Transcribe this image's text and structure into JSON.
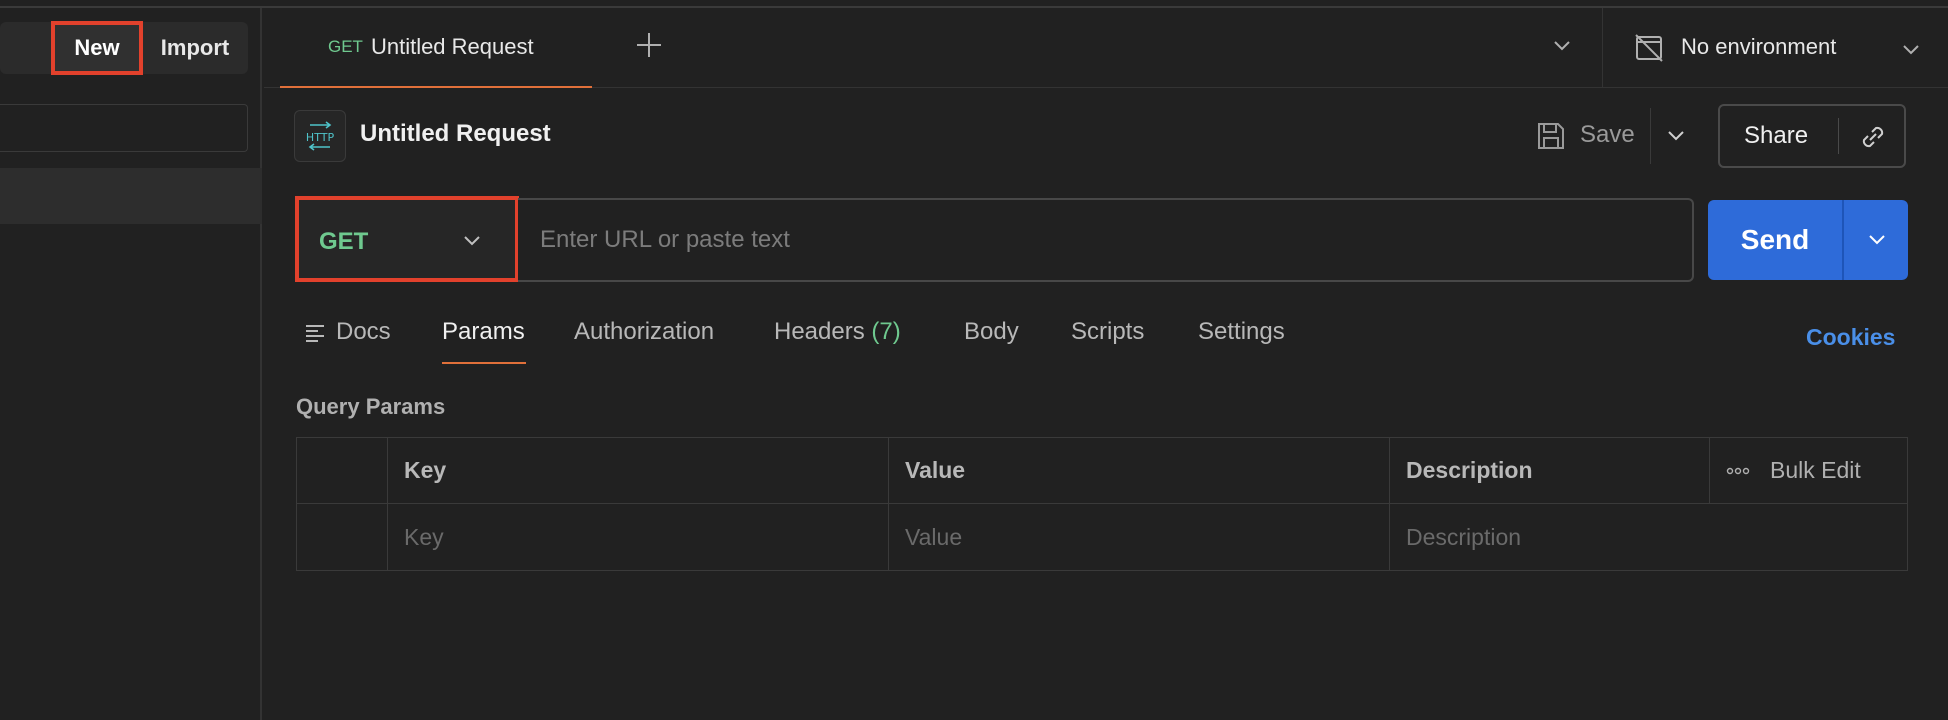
{
  "sidebar": {
    "new_label": "New",
    "import_label": "Import"
  },
  "tabbar": {
    "tab_method": "GET",
    "tab_title": "Untitled Request",
    "environment": "No environment"
  },
  "request": {
    "title": "Untitled Request",
    "save_label": "Save",
    "share_label": "Share",
    "method": "GET",
    "url_placeholder": "Enter URL or paste text",
    "send_label": "Send"
  },
  "subtabs": {
    "docs": "Docs",
    "params": "Params",
    "authorization": "Authorization",
    "headers": "Headers",
    "headers_count": "(7)",
    "body": "Body",
    "scripts": "Scripts",
    "settings": "Settings",
    "cookies": "Cookies"
  },
  "query_params": {
    "title": "Query Params",
    "columns": [
      "Key",
      "Value",
      "Description"
    ],
    "bulk_edit": "Bulk Edit",
    "placeholders": [
      "Key",
      "Value",
      "Description"
    ]
  },
  "colors": {
    "accent_orange": "#e0703a",
    "highlight_red": "#e2412c",
    "method_green": "#6fc98f",
    "send_blue": "#2e6bd9",
    "link_blue": "#4a8fe8"
  }
}
